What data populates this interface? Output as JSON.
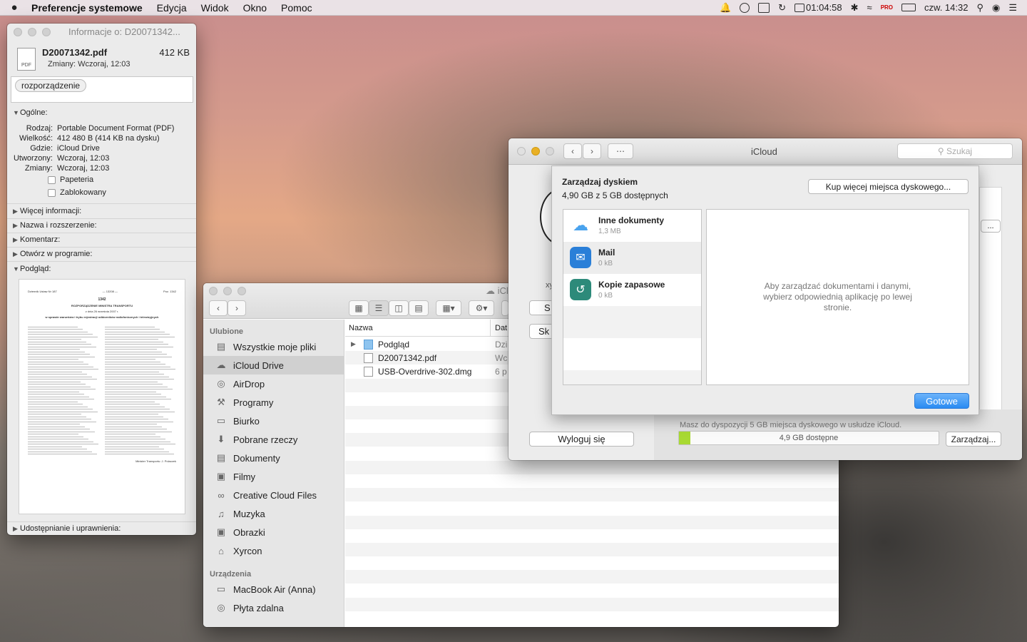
{
  "menubar": {
    "apple": "",
    "app_name": "Preferencje systemowe",
    "menus": [
      "Edycja",
      "Widok",
      "Okno",
      "Pomoc"
    ],
    "timer": "01:04:58",
    "input_badge": "PRO",
    "clock": "czw. 14:32"
  },
  "info_window": {
    "title": "Informacje o: D20071342...",
    "file_name": "D20071342.pdf",
    "file_size": "412 KB",
    "modified": "Zmiany: Wczoraj, 12:03",
    "file_icon_label": "PDF",
    "tag": "rozporządzenie",
    "general_label": "Ogólne:",
    "fields": [
      {
        "k": "Rodzaj:",
        "v": "Portable Document Format (PDF)"
      },
      {
        "k": "Wielkość:",
        "v": "412 480 B (414 KB na dysku)"
      },
      {
        "k": "Gdzie:",
        "v": "iCloud Drive"
      },
      {
        "k": "Utworzony:",
        "v": "Wczoraj, 12:03"
      },
      {
        "k": "Zmiany:",
        "v": "Wczoraj, 12:03"
      }
    ],
    "checkbox_stationery": "Papeteria",
    "checkbox_locked": "Zablokowany",
    "sections": [
      "Więcej informacji:",
      "Nazwa i rozszerzenie:",
      "Komentarz:",
      "Otwórz w programie:"
    ],
    "preview_label": "Podgląd:",
    "sharing_label": "Udostępnianie i uprawnienia:",
    "preview_doc": {
      "header_left": "Dziennik Ustaw Nr 187",
      "header_mid": "— 13208 —",
      "header_right": "Poz. 1342",
      "number": "1342",
      "title": "ROZPORZĄDZENIE MINISTRA TRANSPORTU",
      "date": "z dnia 26 września 2007 r.",
      "subject": "w sprawie warunków i trybu rejestracji odbiorników radiofonicznych i telewizyjnych",
      "signature": "Minister Transportu: J. Polaczek"
    }
  },
  "finder": {
    "path_title": "iCl",
    "favorites_label": "Ulubione",
    "favorites": [
      {
        "label": "Wszystkie moje pliki",
        "icon": "all-files-icon"
      },
      {
        "label": "iCloud Drive",
        "icon": "cloud-icon"
      },
      {
        "label": "AirDrop",
        "icon": "airdrop-icon"
      },
      {
        "label": "Programy",
        "icon": "applications-icon"
      },
      {
        "label": "Biurko",
        "icon": "desktop-icon"
      },
      {
        "label": "Pobrane rzeczy",
        "icon": "downloads-icon"
      },
      {
        "label": "Dokumenty",
        "icon": "documents-icon"
      },
      {
        "label": "Filmy",
        "icon": "movies-icon"
      },
      {
        "label": "Creative Cloud Files",
        "icon": "creative-cloud-icon"
      },
      {
        "label": "Muzyka",
        "icon": "music-icon"
      },
      {
        "label": "Obrazki",
        "icon": "pictures-icon"
      },
      {
        "label": "Xyrcon",
        "icon": "home-icon"
      }
    ],
    "devices_label": "Urządzenia",
    "devices": [
      {
        "label": "MacBook Air (Anna)",
        "icon": "laptop-icon"
      },
      {
        "label": "Płyta zdalna",
        "icon": "disc-icon"
      }
    ],
    "columns": {
      "name": "Nazwa",
      "date": "Dat"
    },
    "files": [
      {
        "name": "Podgląd",
        "date": "Dzi",
        "folder": true
      },
      {
        "name": "D20071342.pdf",
        "date": "Wc",
        "folder": false
      },
      {
        "name": "USB-Overdrive-302.dmg",
        "date": "6 p",
        "folder": false
      }
    ]
  },
  "icloud": {
    "title": "iCloud",
    "search_placeholder": "Szukaj",
    "account_name_fragment": "xy",
    "partial_btn_1": "S",
    "partial_btn_2": "Sk",
    "partial_right_btn": "...",
    "logout": "Wyloguj się",
    "storage_text": "Masz do dyspozycji 5 GB miejsca dyskowego w usłudze iCloud.",
    "storage_bar": "4,9 GB dostępne",
    "storage_used_fraction": 0.02,
    "manage_btn": "Zarządzaj..."
  },
  "sheet": {
    "title": "Zarządzaj dyskiem",
    "subtitle": "4,90 GB z 5 GB dostępnych",
    "buy_btn": "Kup więcej miejsca dyskowego...",
    "apps": [
      {
        "name": "Inne dokumenty",
        "size": "1,3 MB",
        "icon": "cloud-icon",
        "color": "#ffffff"
      },
      {
        "name": "Mail",
        "size": "0 kB",
        "icon": "mail-icon",
        "color": "#2a7fd8"
      },
      {
        "name": "Kopie zapasowe",
        "size": "0 kB",
        "icon": "backup-icon",
        "color": "#2d8a7a"
      }
    ],
    "detail_text": "Aby zarządzać dokumentami i danymi, wybierz odpowiednią aplikację po lewej stronie.",
    "done_btn": "Gotowe"
  }
}
